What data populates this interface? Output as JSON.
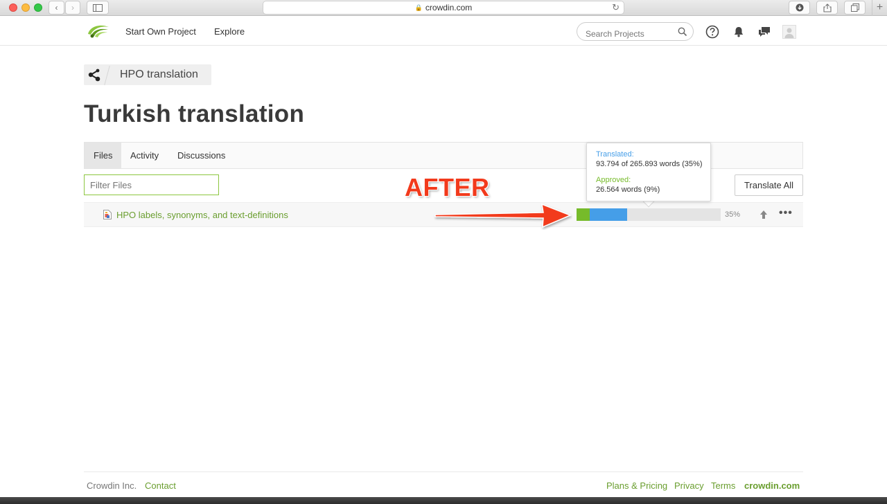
{
  "browser": {
    "url": "crowdin.com",
    "colors": {
      "close": "#fc605b",
      "minimize": "#fdbc40",
      "zoom": "#34c84a"
    }
  },
  "header": {
    "nav": {
      "start_own_project": "Start Own Project",
      "explore": "Explore"
    },
    "search_placeholder": "Search Projects",
    "icons": [
      "help-icon",
      "bell-icon",
      "chat-icon",
      "user-icon"
    ]
  },
  "breadcrumb": {
    "project": "HPO translation"
  },
  "page_title": "Turkish translation",
  "tabs": [
    {
      "label": "Files",
      "active": true
    },
    {
      "label": "Activity",
      "active": false
    },
    {
      "label": "Discussions",
      "active": false
    }
  ],
  "filter_placeholder": "Filter Files",
  "translate_all_label": "Translate All",
  "files": [
    {
      "name": "HPO labels, synonyms, and text-definitions",
      "approved_fraction": 0.09,
      "translated_fraction": 0.35,
      "percent_label": "35%"
    }
  ],
  "tooltip": {
    "translated_caption": "Translated:",
    "translated_value": "93.794 of 265.893 words (35%)",
    "approved_caption": "Approved:",
    "approved_value": "26.564 words (9%)"
  },
  "annotation": {
    "label": "AFTER",
    "color": "#f23a1c"
  },
  "footer": {
    "company": "Crowdin Inc.",
    "contact": "Contact",
    "plans": "Plans & Pricing",
    "privacy": "Privacy",
    "terms": "Terms",
    "brand": "crowdin.com"
  },
  "colors": {
    "accent_green": "#6a9e2f",
    "translated_blue": "#459ee8",
    "approved_green": "#76bb2a"
  }
}
